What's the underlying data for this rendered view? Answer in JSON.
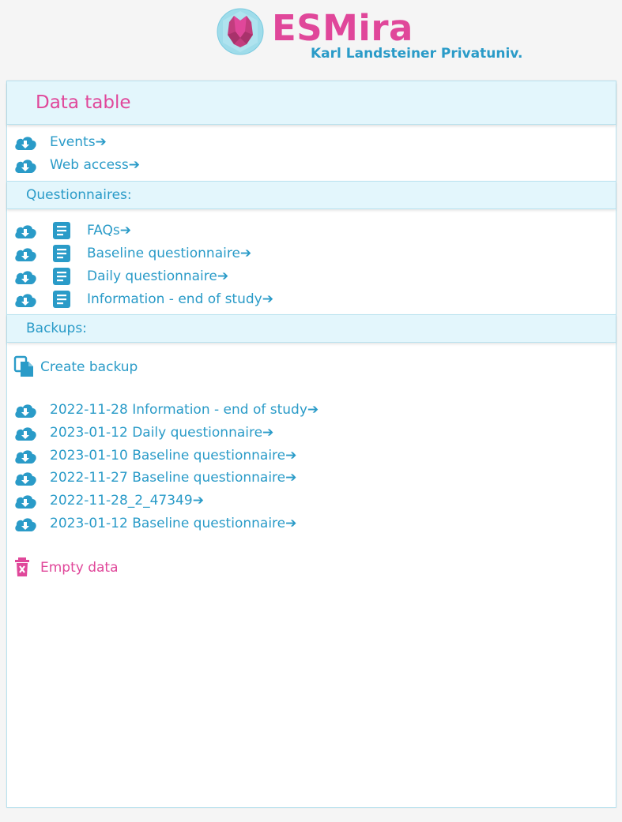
{
  "brand": {
    "title": "ESMira",
    "subtitle": "Karl Landsteiner Privatuniv.",
    "title_color": "#e0479a",
    "subtitle_color": "#2a9bc8"
  },
  "panel": {
    "title": "Data table"
  },
  "general_downloads": [
    {
      "label": "Events➔",
      "icon": "cloud-download-icon"
    },
    {
      "label": "Web access➔",
      "icon": "cloud-download-icon"
    }
  ],
  "questionnaires": {
    "label": "Questionnaires:",
    "items": [
      {
        "label": "FAQs➔",
        "icon": "document-icon"
      },
      {
        "label": "Baseline questionnaire➔",
        "icon": "document-icon"
      },
      {
        "label": "Daily questionnaire➔",
        "icon": "document-icon"
      },
      {
        "label": "Information - end of study➔",
        "icon": "document-icon"
      }
    ]
  },
  "backups": {
    "label": "Backups:",
    "create_label": "Create backup",
    "items": [
      {
        "label": "2022-11-28 Information - end of study➔"
      },
      {
        "label": "2023-01-12 Daily questionnaire➔"
      },
      {
        "label": "2023-01-10 Baseline questionnaire➔"
      },
      {
        "label": "2022-11-27 Baseline questionnaire➔"
      },
      {
        "label": "2022-11-28_2_47349➔"
      },
      {
        "label": "2023-01-12 Baseline questionnaire➔"
      }
    ]
  },
  "danger": {
    "empty_label": "Empty data",
    "color": "#e0479a"
  },
  "colors": {
    "accent": "#2a9bc8",
    "section_bg": "#e3f6fc"
  }
}
